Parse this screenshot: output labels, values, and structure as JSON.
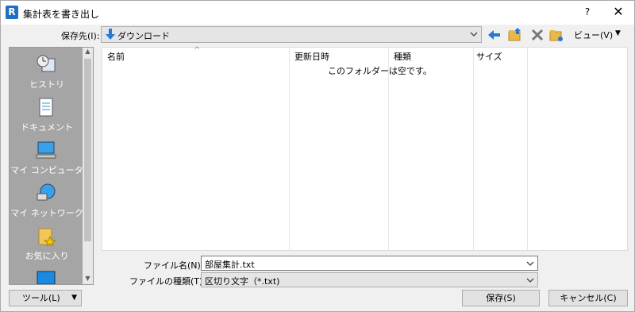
{
  "window": {
    "title": "集計表を書き出し",
    "help": "?",
    "close": "✕"
  },
  "toolbar": {
    "save_in_label": "保存先(I):",
    "save_in_value": "ダウンロード",
    "view_label": "ビュー(V)"
  },
  "places": [
    {
      "label": "ヒストリ",
      "icon": "history-icon"
    },
    {
      "label": "ドキュメント",
      "icon": "documents-icon"
    },
    {
      "label": "マイ コンピュータ",
      "icon": "computer-icon"
    },
    {
      "label": "マイ ネットワーク",
      "icon": "network-icon"
    },
    {
      "label": "お気に入り",
      "icon": "favorites-icon"
    }
  ],
  "filelist": {
    "columns": [
      "名前",
      "更新日時",
      "種類",
      "サイズ"
    ],
    "empty_message": "このフォルダーは空です。"
  },
  "form": {
    "filename_label": "ファイル名(N):",
    "filename_value": "部屋集計.txt",
    "filetype_label": "ファイルの種類(T):",
    "filetype_value": "区切り文字（*.txt)"
  },
  "buttons": {
    "tools": "ツール(L)",
    "save": "保存(S)",
    "cancel": "キャンセル(C)"
  }
}
